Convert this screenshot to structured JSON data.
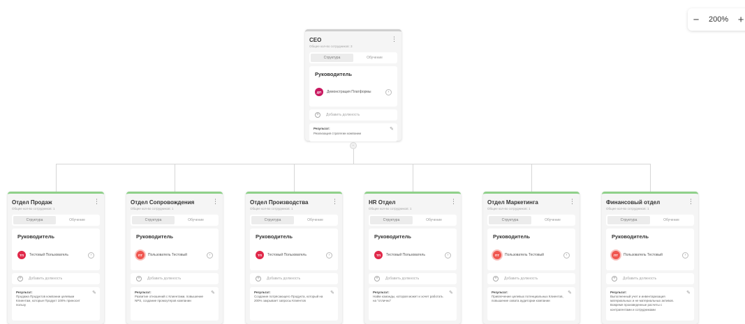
{
  "zoom": {
    "minus": "−",
    "value": "200%",
    "plus": "+"
  },
  "ceo": {
    "title": "CEO",
    "subtitle": "Общее кол-во сотрудников: 3",
    "tabs": [
      "Структура",
      "Обучение"
    ],
    "leader_heading": "Руководитель",
    "leader": {
      "initials": "ДП",
      "name": "Демонстрация Платформы",
      "color": "magenta"
    },
    "add_position": "Добавить должность",
    "result_label": "Результат:",
    "result_text": "Реализация стратегии компании"
  },
  "departments": [
    {
      "title": "Отдел Продаж",
      "subtitle": "Общее кол-во сотрудников: 1",
      "tabs": [
        "Структура",
        "Обучение"
      ],
      "leader_heading": "Руководитель",
      "leader": {
        "initials": "ТП",
        "name": "Тестовый Пользователь",
        "color": "red"
      },
      "add_position": "Добавить должность",
      "result_label": "Результат:",
      "result_text": "Продажа Продуктов компании целевым Клиентам, которые Продукт 100% приносит пользу"
    },
    {
      "title": "Отдел Сопровождения",
      "subtitle": "Общее кол-во сотрудников: 1",
      "tabs": [
        "Структура",
        "Обучение"
      ],
      "leader_heading": "Руководитель",
      "leader": {
        "initials": "ПТ",
        "name": "Пользователь Тестовый",
        "color": "salmon"
      },
      "add_position": "Добавить должность",
      "result_label": "Результат:",
      "result_text": "Развитие отношений с Клиентами, повышение NPS, создание промоутеров компании"
    },
    {
      "title": "Отдел Производства",
      "subtitle": "Общее кол-во сотрудников: 1",
      "tabs": [
        "Структура",
        "Обучение"
      ],
      "leader_heading": "Руководитель",
      "leader": {
        "initials": "ТП",
        "name": "Тестовый Пользователь",
        "color": "red"
      },
      "add_position": "Добавить должность",
      "result_label": "Результат:",
      "result_text": "Создание потрясающего Продукта, который на 200% закрывает запросы Клиентов"
    },
    {
      "title": "HR Отдел",
      "subtitle": "Общее кол-во сотрудников: 1",
      "tabs": [
        "Структура",
        "Обучение"
      ],
      "leader_heading": "Руководитель",
      "leader": {
        "initials": "ТП",
        "name": "Тестовый Пользователь",
        "color": "red"
      },
      "add_position": "Добавить должность",
      "result_label": "Результат:",
      "result_text": "Найм команды, которая может и хочет работать на \"отлично\""
    },
    {
      "title": "Отдел Маркетинга",
      "subtitle": "Общее кол-во сотрудников: 1",
      "tabs": [
        "Структура",
        "Обучение"
      ],
      "leader_heading": "Руководитель",
      "leader": {
        "initials": "ПТ",
        "name": "Пользователь Тестовый",
        "color": "salmon"
      },
      "add_position": "Добавить должность",
      "result_label": "Результат:",
      "result_text": "Привлечение целевых потенциальных Клиентов, повышение охвата аудитории компании"
    },
    {
      "title": "Финансовый отдел",
      "subtitle": "Общее кол-во сотрудников: 1",
      "tabs": [
        "Структура",
        "Обучение"
      ],
      "leader_heading": "Руководитель",
      "leader": {
        "initials": "ПТ",
        "name": "Пользователь Тестовый",
        "color": "salmon"
      },
      "add_position": "Добавить должность",
      "result_label": "Результат:",
      "result_text": "Выполненный учет и инвентаризация материальных и не материальных активов. Вовремя произведенные расчеты с контрагентами и сотрудниками"
    }
  ]
}
